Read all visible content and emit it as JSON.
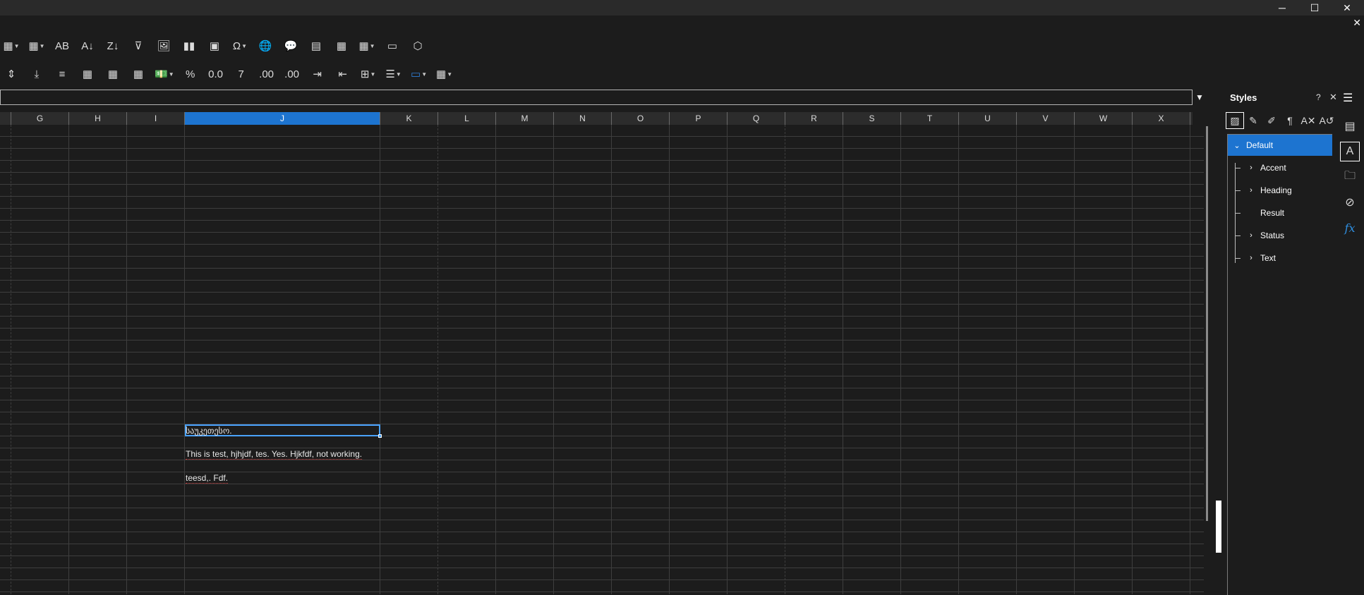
{
  "window": {
    "minimize_glyph": "─",
    "maximize_glyph": "☐",
    "close_glyph": "✕",
    "doc_close_glyph": "✕"
  },
  "toolbar_row1": [
    {
      "name": "insert-rows-icon",
      "glyph": "▦",
      "dropdown": true
    },
    {
      "name": "insert-columns-icon",
      "glyph": "▦",
      "dropdown": true
    },
    {
      "name": "spellcheck-icon",
      "glyph": "AB"
    },
    {
      "name": "sort-ascending-icon",
      "glyph": "A↓"
    },
    {
      "name": "sort-descending-icon",
      "glyph": "Z↓"
    },
    {
      "name": "autofilter-icon",
      "glyph": "⊽"
    },
    {
      "name": "insert-image-icon",
      "glyph": "🖼"
    },
    {
      "name": "insert-chart-icon",
      "glyph": "▮▮"
    },
    {
      "name": "pivot-table-icon",
      "glyph": "▣"
    },
    {
      "name": "special-character-icon",
      "glyph": "Ω",
      "dropdown": true
    },
    {
      "name": "hyperlink-icon",
      "glyph": "🌐"
    },
    {
      "name": "comment-icon",
      "glyph": "💬"
    },
    {
      "name": "header-footer-icon",
      "glyph": "▤"
    },
    {
      "name": "define-print-area-icon",
      "glyph": "▦"
    },
    {
      "name": "freeze-rows-columns-icon",
      "glyph": "▦",
      "dropdown": true
    },
    {
      "name": "split-window-icon",
      "glyph": "▭"
    },
    {
      "name": "show-draw-functions-icon",
      "glyph": "⬡"
    }
  ],
  "toolbar_row2": [
    {
      "name": "align-center-vertical-icon",
      "glyph": "⇕"
    },
    {
      "name": "align-bottom-icon",
      "glyph": "⤓"
    },
    {
      "name": "wrap-text-icon",
      "glyph": "≡"
    },
    {
      "name": "merge-center-icon",
      "glyph": "▦"
    },
    {
      "name": "merge-cells-icon",
      "glyph": "▦"
    },
    {
      "name": "unmerge-cells-icon",
      "glyph": "▦"
    },
    {
      "name": "currency-format-icon",
      "glyph": "💵",
      "dropdown": true
    },
    {
      "name": "percent-format-icon",
      "glyph": "%"
    },
    {
      "name": "number-format-icon",
      "glyph": "0.0"
    },
    {
      "name": "date-format-icon",
      "glyph": "7"
    },
    {
      "name": "add-decimal-icon",
      "glyph": ".00"
    },
    {
      "name": "delete-decimal-icon",
      "glyph": ".00"
    },
    {
      "name": "increase-indent-icon",
      "glyph": "⇥"
    },
    {
      "name": "decrease-indent-icon",
      "glyph": "⇤"
    },
    {
      "name": "borders-icon",
      "glyph": "⊞",
      "dropdown": true
    },
    {
      "name": "border-style-icon",
      "glyph": "☰",
      "dropdown": true
    },
    {
      "name": "border-color-icon",
      "glyph": "▭",
      "dropdown": true,
      "color": "#2f7fd8"
    },
    {
      "name": "conditional-format-icon",
      "glyph": "▦",
      "dropdown": true
    }
  ],
  "formula_bar": {
    "value": "",
    "expand_glyph": "▼"
  },
  "columns": [
    "G",
    "H",
    "I",
    "J",
    "K",
    "L",
    "M",
    "N",
    "O",
    "P",
    "Q",
    "R",
    "S",
    "T",
    "U",
    "V",
    "W",
    "X"
  ],
  "selected_column": "J",
  "cells": {
    "j_active": "საუკეთესო.",
    "j_row2": "This is test, hjhjdf, tes. Yes. Hjkfdf, not working.",
    "j_row3": "teesd,. Fdf."
  },
  "styles_panel": {
    "title": "Styles",
    "help_glyph": "?",
    "close_glyph": "✕",
    "tools": [
      {
        "name": "cell-styles-icon",
        "glyph": "▨",
        "active": true
      },
      {
        "name": "page-styles-icon",
        "glyph": "✎"
      },
      {
        "name": "fill-format-mode-icon",
        "glyph": "✐"
      },
      {
        "name": "new-style-from-selection-icon",
        "glyph": "¶"
      },
      {
        "name": "update-style-icon",
        "glyph": "A✕"
      },
      {
        "name": "style-actions-icon",
        "glyph": "A↺"
      }
    ],
    "items": [
      {
        "label": "Default",
        "expander": "⌄",
        "level": 0,
        "selected": true
      },
      {
        "label": "Accent",
        "expander": "›",
        "level": 1
      },
      {
        "label": "Heading",
        "expander": "›",
        "level": 1
      },
      {
        "label": "Result",
        "expander": "",
        "level": 1
      },
      {
        "label": "Status",
        "expander": "›",
        "level": 1
      },
      {
        "label": "Text",
        "expander": "›",
        "level": 1
      }
    ]
  },
  "deck": {
    "menu_glyph": "☰",
    "buttons": [
      {
        "name": "properties-deck-icon",
        "glyph": "▤"
      },
      {
        "name": "styles-deck-icon",
        "glyph": "A",
        "active": true
      },
      {
        "name": "gallery-deck-icon",
        "glyph": "🗀"
      },
      {
        "name": "navigator-deck-icon",
        "glyph": "⊘"
      },
      {
        "name": "functions-deck-icon",
        "glyph": "fx"
      }
    ]
  }
}
